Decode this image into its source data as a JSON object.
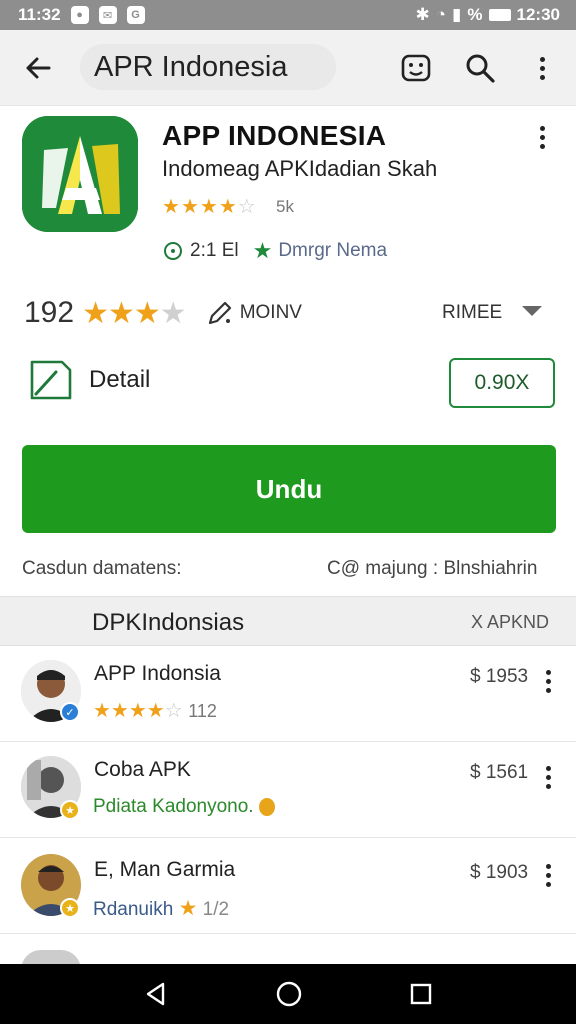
{
  "status_bar": {
    "time_left": "11:32",
    "time_right": "12:30",
    "signal_text": "%"
  },
  "app_bar": {
    "search_text": "APR Indonesia"
  },
  "app": {
    "title": "APP INDONESIA",
    "subtitle": "Indomeag APKIdadian Skah",
    "small_rating_text": "5k",
    "small_rating_value": 4,
    "size_text": "2:1 El",
    "developer_text": "Dmrgr Nema"
  },
  "rating_row": {
    "count": "192",
    "stars_value": 3,
    "write_label": "MOINV",
    "sort_label": "RIMEE"
  },
  "detail": {
    "label": "Detail",
    "price": "0.90X"
  },
  "download": {
    "label": "Undu"
  },
  "info": {
    "left": "Casdun damatens:",
    "right": "C@ majung : Blnshiahrin"
  },
  "section": {
    "title": "DPKIndonsias",
    "right": "X APKND"
  },
  "list": [
    {
      "title": "APP Indonsia",
      "sub": "112",
      "sub_kind": "stars",
      "stars": 4,
      "price": "$ 1953",
      "badge": "check"
    },
    {
      "title": "Coba APK",
      "sub": "Pdiata Kadonyono.",
      "sub_kind": "text",
      "price": "$ 1561",
      "badge": "star"
    },
    {
      "title": "E, Man Garmia",
      "sub": "Rdanuikh",
      "sub_kind": "mixed",
      "stars": 1,
      "extra": "1/2",
      "price": "$ 1903",
      "badge": "star"
    }
  ],
  "colors": {
    "accent_green": "#1e9a1e",
    "star": "#f0a11a",
    "status_bar": "#8e8e8e"
  },
  "icons": [
    "back-arrow-icon",
    "screenshot-icon",
    "search-icon",
    "more-vert-icon",
    "star-icon",
    "pencil-icon",
    "chevron-down-icon",
    "edit-icon",
    "nav-back-icon",
    "nav-home-icon",
    "nav-recents-icon"
  ]
}
